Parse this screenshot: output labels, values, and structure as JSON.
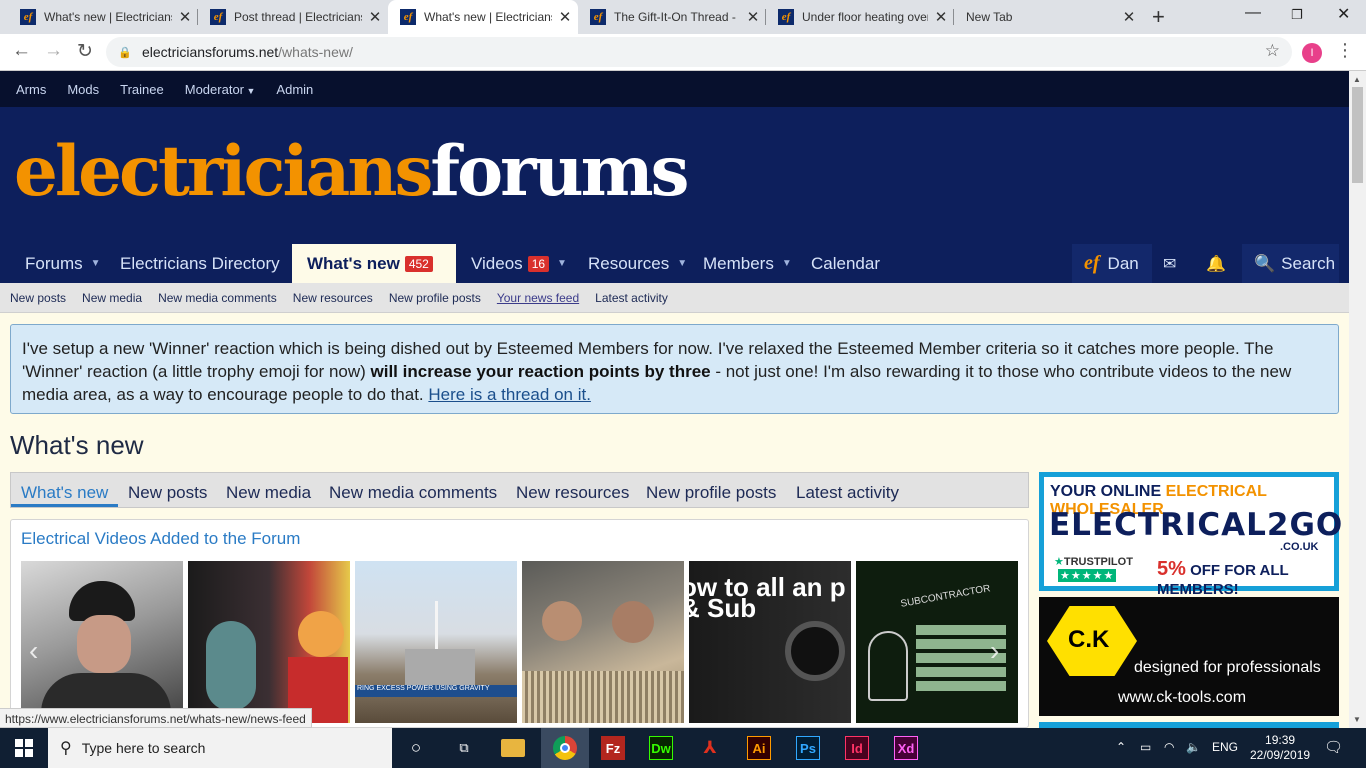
{
  "browser": {
    "tabs": [
      {
        "title": "What's new | Electricians Forums",
        "favicon": "ef",
        "active": false
      },
      {
        "title": "Post thread | Electricians Forums",
        "favicon": "ef",
        "active": false
      },
      {
        "title": "What's new | Electricians Forums",
        "favicon": "ef",
        "active": true
      },
      {
        "title": "The Gift-It-On Thread - Electricians Forums",
        "favicon": "ef",
        "active": false
      },
      {
        "title": "Under floor heating over electrical",
        "favicon": "ef",
        "active": false
      },
      {
        "title": "New Tab",
        "favicon": "",
        "active": false
      }
    ],
    "url_host": "electriciansforums.net",
    "url_path": "/whats-new/",
    "profile_initial": "I",
    "status_url": "https://www.electriciansforums.net/whats-new/news-feed"
  },
  "staff_bar": [
    "Arms",
    "Mods",
    "Trainee",
    "Moderator",
    "Admin"
  ],
  "logo": {
    "part1": "electricians",
    "part2": "forums"
  },
  "nav": {
    "forums": "Forums",
    "directory": "Electricians Directory",
    "whats_new": "What's new",
    "whats_new_badge": "452",
    "videos": "Videos",
    "videos_badge": "16",
    "resources": "Resources",
    "members": "Members",
    "calendar": "Calendar",
    "user_logo": "ef",
    "user_name": "Dan",
    "search": "Search"
  },
  "subnav": [
    "New posts",
    "New media",
    "New media comments",
    "New resources",
    "New profile posts",
    "Your news feed",
    "Latest activity"
  ],
  "notice": {
    "text1": "I've setup a new 'Winner' reaction which is being dished out by Esteemed Members for now. I've relaxed the Esteemed Member criteria so it catches more people. The 'Winner' reaction (a little trophy emoji for now) ",
    "bold": "will increase your reaction points by three",
    "text2": " - not just one! I'm also rewarding it to those who contribute videos to the new media area, as a way to encourage people to do that. ",
    "link": "Here is a thread on it."
  },
  "page_title": "What's new",
  "content_tabs": [
    "What's new",
    "New posts",
    "New media",
    "New media comments",
    "New resources",
    "New profile posts",
    "Latest activity"
  ],
  "videos_block": {
    "title": "Electrical Videos Added to the Forum",
    "thumb3_caption": "RING EXCESS POWER USING GRAVITY",
    "thumb5_text": "ow to all an p & Sub",
    "thumb6_text": "SUBCONTRACTOR"
  },
  "ads": {
    "ad1_line_a": "YOUR ONLINE",
    "ad1_line_b": "ELECTRICAL WHOLESALER",
    "ad1_brand": "ELECTRICAL2GO",
    "ad1_couk": ".CO.UK",
    "ad1_trustpilot": "TRUSTPILOT",
    "ad1_stars": "★★★★★",
    "ad1_pct": "5%",
    "ad1_offer": " OFF FOR ALL MEMBERS!",
    "ad2_logo": "C.K",
    "ad2_tag": "designed for professionals",
    "ad2_url": "www.ck-tools.com"
  },
  "taskbar": {
    "search_placeholder": "Type here to search",
    "lang": "ENG",
    "time": "19:39",
    "date": "22/09/2019",
    "apps": [
      "task-view",
      "file-explorer",
      "chrome",
      "filezilla",
      "dreamweaver",
      "acrobat",
      "illustrator",
      "photoshop",
      "indesign",
      "xd"
    ],
    "app_labels": {
      "dw": "Dw",
      "ai": "Ai",
      "ps": "Ps",
      "id": "Id",
      "xd": "Xd",
      "fz": "Fz"
    }
  }
}
